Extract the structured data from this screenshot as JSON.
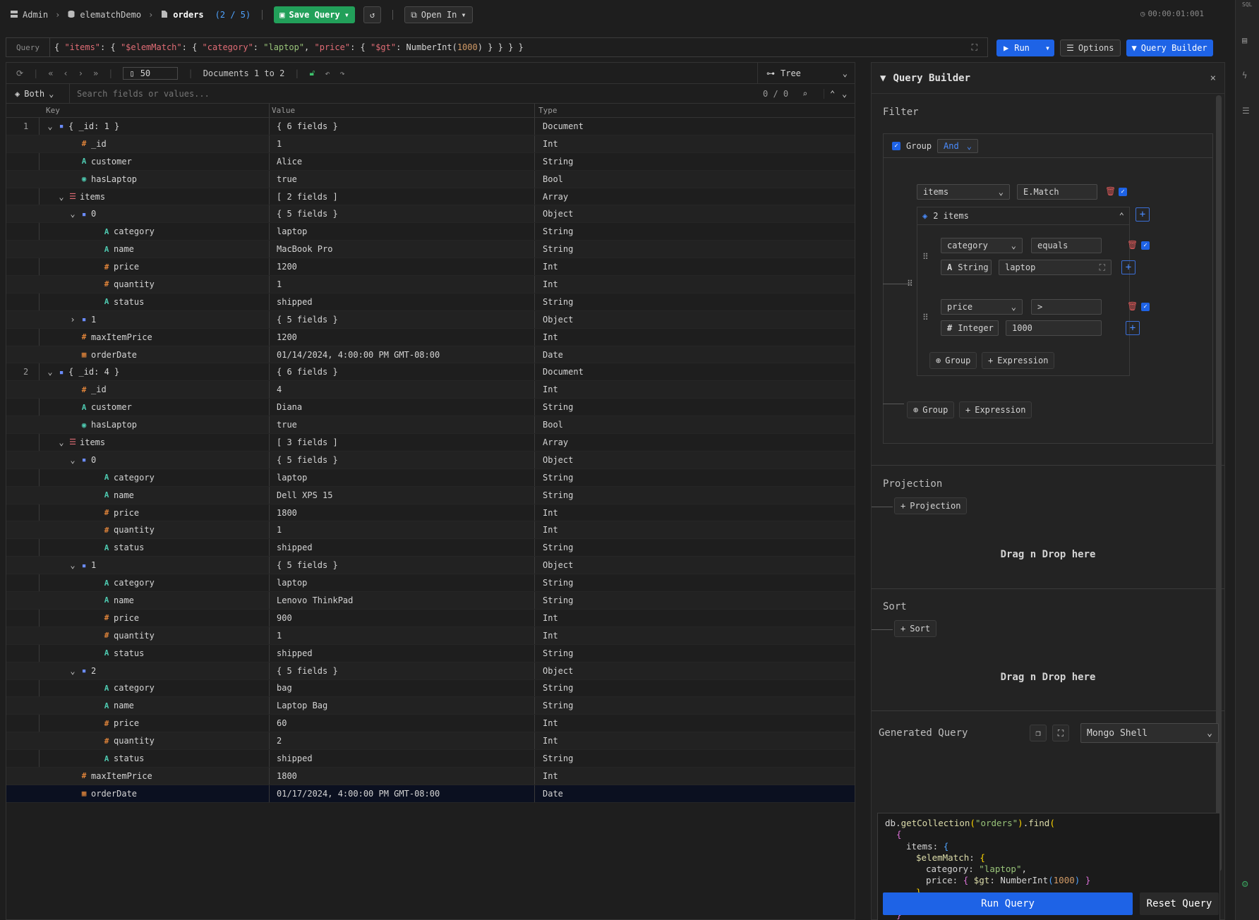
{
  "topbar": {
    "breadcrumb": [
      "Admin",
      "elematchDemo",
      "orders"
    ],
    "count": "(2 / 5)",
    "save_query": "Save Query",
    "open_in": "Open In",
    "timer": "00:00:01:001"
  },
  "query": {
    "label": "Query",
    "text": "{ \"items\": { \"$elemMatch\": { \"category\": \"laptop\", \"price\": { \"$gt\": NumberInt(1000) } } } }",
    "run": "Run",
    "options": "Options",
    "query_builder": "Query Builder"
  },
  "toolbar": {
    "page_size": "50",
    "docs_label": "Documents 1 to 2",
    "view_mode": "Tree",
    "filter_mode": "Both",
    "search_placeholder": "Search fields or values...",
    "match_count": "0 / 0"
  },
  "columns": [
    "Key",
    "Value",
    "Type"
  ],
  "rows": [
    {
      "doc": "1",
      "depth": 0,
      "chev": "down",
      "icon": "doc",
      "key": "{ _id: 1 }",
      "value": "{ 6 fields }",
      "type": "Document"
    },
    {
      "doc": "",
      "depth": 2,
      "chev": "",
      "icon": "hash",
      "key": "_id",
      "value": "1",
      "type": "Int"
    },
    {
      "doc": "",
      "depth": 2,
      "chev": "",
      "icon": "A",
      "key": "customer",
      "value": "Alice",
      "type": "String"
    },
    {
      "doc": "",
      "depth": 2,
      "chev": "",
      "icon": "bool",
      "key": "hasLaptop",
      "value": "true",
      "type": "Bool"
    },
    {
      "doc": "",
      "depth": 1,
      "chev": "down",
      "icon": "arr",
      "key": "items",
      "value": "[ 2 fields ]",
      "type": "Array"
    },
    {
      "doc": "",
      "depth": 2,
      "chev": "down",
      "icon": "doc",
      "key": "0",
      "value": "{ 5 fields }",
      "type": "Object"
    },
    {
      "doc": "",
      "depth": 4,
      "chev": "",
      "icon": "A",
      "key": "category",
      "value": "laptop",
      "type": "String"
    },
    {
      "doc": "",
      "depth": 4,
      "chev": "",
      "icon": "A",
      "key": "name",
      "value": "MacBook Pro",
      "type": "String"
    },
    {
      "doc": "",
      "depth": 4,
      "chev": "",
      "icon": "hash",
      "key": "price",
      "value": "1200",
      "type": "Int"
    },
    {
      "doc": "",
      "depth": 4,
      "chev": "",
      "icon": "hash",
      "key": "quantity",
      "value": "1",
      "type": "Int"
    },
    {
      "doc": "",
      "depth": 4,
      "chev": "",
      "icon": "A",
      "key": "status",
      "value": "shipped",
      "type": "String"
    },
    {
      "doc": "",
      "depth": 2,
      "chev": "right",
      "icon": "doc",
      "key": "1",
      "value": "{ 5 fields }",
      "type": "Object"
    },
    {
      "doc": "",
      "depth": 2,
      "chev": "",
      "icon": "hash",
      "key": "maxItemPrice",
      "value": "1200",
      "type": "Int"
    },
    {
      "doc": "",
      "depth": 2,
      "chev": "",
      "icon": "date",
      "key": "orderDate",
      "value": "01/14/2024, 4:00:00 PM GMT-08:00",
      "type": "Date"
    },
    {
      "doc": "2",
      "depth": 0,
      "chev": "down",
      "icon": "doc",
      "key": "{ _id: 4 }",
      "value": "{ 6 fields }",
      "type": "Document"
    },
    {
      "doc": "",
      "depth": 2,
      "chev": "",
      "icon": "hash",
      "key": "_id",
      "value": "4",
      "type": "Int"
    },
    {
      "doc": "",
      "depth": 2,
      "chev": "",
      "icon": "A",
      "key": "customer",
      "value": "Diana",
      "type": "String"
    },
    {
      "doc": "",
      "depth": 2,
      "chev": "",
      "icon": "bool",
      "key": "hasLaptop",
      "value": "true",
      "type": "Bool"
    },
    {
      "doc": "",
      "depth": 1,
      "chev": "down",
      "icon": "arr",
      "key": "items",
      "value": "[ 3 fields ]",
      "type": "Array"
    },
    {
      "doc": "",
      "depth": 2,
      "chev": "down",
      "icon": "doc",
      "key": "0",
      "value": "{ 5 fields }",
      "type": "Object"
    },
    {
      "doc": "",
      "depth": 4,
      "chev": "",
      "icon": "A",
      "key": "category",
      "value": "laptop",
      "type": "String"
    },
    {
      "doc": "",
      "depth": 4,
      "chev": "",
      "icon": "A",
      "key": "name",
      "value": "Dell XPS 15",
      "type": "String"
    },
    {
      "doc": "",
      "depth": 4,
      "chev": "",
      "icon": "hash",
      "key": "price",
      "value": "1800",
      "type": "Int"
    },
    {
      "doc": "",
      "depth": 4,
      "chev": "",
      "icon": "hash",
      "key": "quantity",
      "value": "1",
      "type": "Int"
    },
    {
      "doc": "",
      "depth": 4,
      "chev": "",
      "icon": "A",
      "key": "status",
      "value": "shipped",
      "type": "String"
    },
    {
      "doc": "",
      "depth": 2,
      "chev": "down",
      "icon": "doc",
      "key": "1",
      "value": "{ 5 fields }",
      "type": "Object"
    },
    {
      "doc": "",
      "depth": 4,
      "chev": "",
      "icon": "A",
      "key": "category",
      "value": "laptop",
      "type": "String"
    },
    {
      "doc": "",
      "depth": 4,
      "chev": "",
      "icon": "A",
      "key": "name",
      "value": "Lenovo ThinkPad",
      "type": "String"
    },
    {
      "doc": "",
      "depth": 4,
      "chev": "",
      "icon": "hash",
      "key": "price",
      "value": "900",
      "type": "Int"
    },
    {
      "doc": "",
      "depth": 4,
      "chev": "",
      "icon": "hash",
      "key": "quantity",
      "value": "1",
      "type": "Int"
    },
    {
      "doc": "",
      "depth": 4,
      "chev": "",
      "icon": "A",
      "key": "status",
      "value": "shipped",
      "type": "String"
    },
    {
      "doc": "",
      "depth": 2,
      "chev": "down",
      "icon": "doc",
      "key": "2",
      "value": "{ 5 fields }",
      "type": "Object"
    },
    {
      "doc": "",
      "depth": 4,
      "chev": "",
      "icon": "A",
      "key": "category",
      "value": "bag",
      "type": "String"
    },
    {
      "doc": "",
      "depth": 4,
      "chev": "",
      "icon": "A",
      "key": "name",
      "value": "Laptop Bag",
      "type": "String"
    },
    {
      "doc": "",
      "depth": 4,
      "chev": "",
      "icon": "hash",
      "key": "price",
      "value": "60",
      "type": "Int"
    },
    {
      "doc": "",
      "depth": 4,
      "chev": "",
      "icon": "hash",
      "key": "quantity",
      "value": "2",
      "type": "Int"
    },
    {
      "doc": "",
      "depth": 4,
      "chev": "",
      "icon": "A",
      "key": "status",
      "value": "shipped",
      "type": "String"
    },
    {
      "doc": "",
      "depth": 2,
      "chev": "",
      "icon": "hash",
      "key": "maxItemPrice",
      "value": "1800",
      "type": "Int"
    },
    {
      "doc": "",
      "depth": 2,
      "chev": "",
      "icon": "date",
      "key": "orderDate",
      "value": "01/17/2024, 4:00:00 PM GMT-08:00",
      "type": "Date",
      "selected": true
    }
  ],
  "qb": {
    "title": "Query Builder",
    "filter": "Filter",
    "group_label": "Group",
    "group_op": "And",
    "field1": "items",
    "op1": "E.Match",
    "sub_items": "2 items",
    "c1_field": "category",
    "c1_op": "equals",
    "c1_type": "String",
    "c1_value": "laptop",
    "c2_field": "price",
    "c2_op": ">",
    "c2_type": "Integer",
    "c2_value": "1000",
    "add_group": "Group",
    "add_expression": "Expression",
    "projection": "Projection",
    "add_projection": "Projection",
    "drag_drop": "Drag n Drop here",
    "sort": "Sort",
    "add_sort": "Sort",
    "generated": "Generated Query",
    "shell": "Mongo Shell",
    "run_query": "Run Query",
    "reset_query": "Reset Query"
  },
  "colors": {
    "accent": "#1e63e6",
    "save": "#22a05a",
    "bg": "#1e1e1e"
  }
}
